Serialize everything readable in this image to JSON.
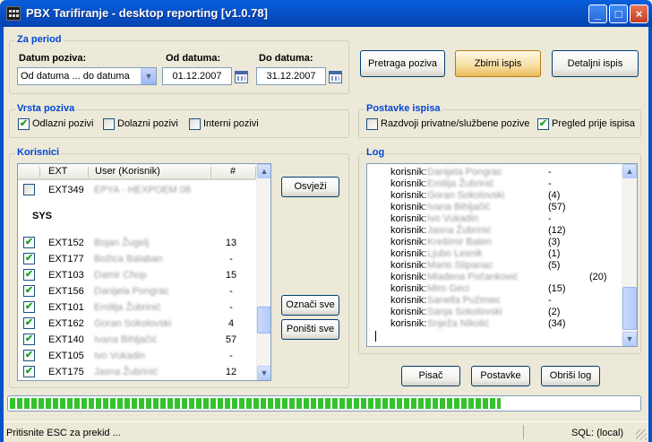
{
  "window": {
    "title": "PBX Tarifiranje - desktop reporting [v1.0.78]",
    "buttons": [
      "minimize",
      "maximize",
      "close"
    ]
  },
  "period": {
    "legend": "Za period",
    "date_label": "Datum poziva:",
    "date_select": "Od datuma ... do datuma",
    "from_label": "Od datuma:",
    "from_value": "01.12.2007",
    "to_label": "Do datuma:",
    "to_value": "31.12.2007"
  },
  "actions": {
    "search": "Pretraga poziva",
    "summary": "Zbirni ispis",
    "detail": "Detaljni ispis"
  },
  "call_type": {
    "legend": "Vrsta poziva",
    "outgoing": {
      "label": "Odlazni pozivi",
      "checked": true
    },
    "incoming": {
      "label": "Dolazni pozivi",
      "checked": false
    },
    "internal": {
      "label": "Interni pozivi",
      "checked": false
    }
  },
  "print_settings": {
    "legend": "Postavke ispisa",
    "split": {
      "label": "Razdvoji privatne/službene pozive",
      "checked": false
    },
    "preview": {
      "label": "Pregled prije ispisa",
      "checked": true
    }
  },
  "users": {
    "legend": "Korisnici",
    "columns": {
      "ext": "EXT",
      "user": "User (Korisnik)",
      "count": "#"
    },
    "top_row": {
      "ext": "EXT349",
      "user": "EPYA - HEXPOEM 08",
      "count": "",
      "checked": false
    },
    "group": "SYS",
    "rows": [
      {
        "ext": "EXT152",
        "user": "Bojan Žugelj",
        "count": "13",
        "checked": true
      },
      {
        "ext": "EXT177",
        "user": "Božica Balaban",
        "count": "-",
        "checked": true
      },
      {
        "ext": "EXT103",
        "user": "Damir Chop",
        "count": "15",
        "checked": true
      },
      {
        "ext": "EXT156",
        "user": "Danijela Pongrac",
        "count": "-",
        "checked": true
      },
      {
        "ext": "EXT101",
        "user": "Emilija Žubrinić",
        "count": "-",
        "checked": true
      },
      {
        "ext": "EXT162",
        "user": "Goran Sokolovski",
        "count": "4",
        "checked": true
      },
      {
        "ext": "EXT140",
        "user": "Ivana Bihljačić",
        "count": "57",
        "checked": true
      },
      {
        "ext": "EXT105",
        "user": "Ivo Vukadin",
        "count": "-",
        "checked": true
      },
      {
        "ext": "EXT175",
        "user": "Jasna Žubrinić",
        "count": "12",
        "checked": true
      }
    ],
    "refresh": "Osvježi",
    "select_all": "Označi sve",
    "clear_all": "Poništi sve"
  },
  "log": {
    "legend": "Log",
    "prefix": "korisnik:",
    "lines": [
      {
        "name": "Danijela Pongrac",
        "value": "-"
      },
      {
        "name": "Emilija Žubrinić",
        "value": "-"
      },
      {
        "name": "Goran Sokolovski",
        "value": "(4)"
      },
      {
        "name": "Ivana Bihljačić",
        "value": "(57)"
      },
      {
        "name": "Ivo Vukadin",
        "value": "-"
      },
      {
        "name": "Jasna Žubrinić",
        "value": "(12)"
      },
      {
        "name": "Krešimir Baten",
        "value": "(3)"
      },
      {
        "name": "Ljubo Lesnik",
        "value": "(1)"
      },
      {
        "name": "Mario Stipanac",
        "value": "(5)"
      },
      {
        "name": "Mladena Počanković",
        "value": "(20)"
      },
      {
        "name": "Miro Geci",
        "value": "(15)"
      },
      {
        "name": "Sanella Pužimec",
        "value": "-"
      },
      {
        "name": "Sanja Sokolovski",
        "value": "(2)"
      },
      {
        "name": "Snježa Nikolić",
        "value": "(34)"
      }
    ],
    "printer": "Pisač",
    "settings": "Postavke",
    "clear": "Obriši log"
  },
  "progress": {
    "fraction": 0.78
  },
  "status": {
    "hint": "Pritisnite ESC za prekid ...",
    "sql": "SQL: (local)"
  }
}
